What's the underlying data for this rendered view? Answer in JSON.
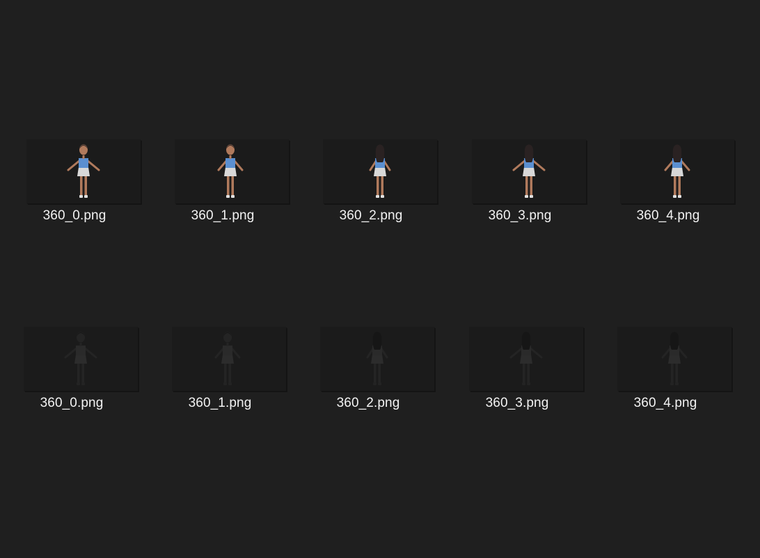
{
  "window": {
    "background": "#1f1f1f"
  },
  "rows": [
    {
      "variant": "color",
      "files": [
        {
          "name": "360_0.png",
          "view": "front"
        },
        {
          "name": "360_1.png",
          "view": "three-quarter-front"
        },
        {
          "name": "360_2.png",
          "view": "side"
        },
        {
          "name": "360_3.png",
          "view": "back"
        },
        {
          "name": "360_4.png",
          "view": "three-quarter-back"
        }
      ]
    },
    {
      "variant": "dark",
      "files": [
        {
          "name": "360_0.png",
          "view": "front"
        },
        {
          "name": "360_1.png",
          "view": "three-quarter-front"
        },
        {
          "name": "360_2.png",
          "view": "side"
        },
        {
          "name": "360_3.png",
          "view": "back"
        },
        {
          "name": "360_4.png",
          "view": "three-quarter-back"
        }
      ]
    }
  ],
  "colors": {
    "skin": "#b07a5c",
    "shirt": "#5b8fd0",
    "skirt": "#d8d8d8",
    "hair": "#2a2222",
    "shoe": "#e0e0e0",
    "dark_figure": "#2b2b2b",
    "label_text": "#f2f2f2"
  }
}
